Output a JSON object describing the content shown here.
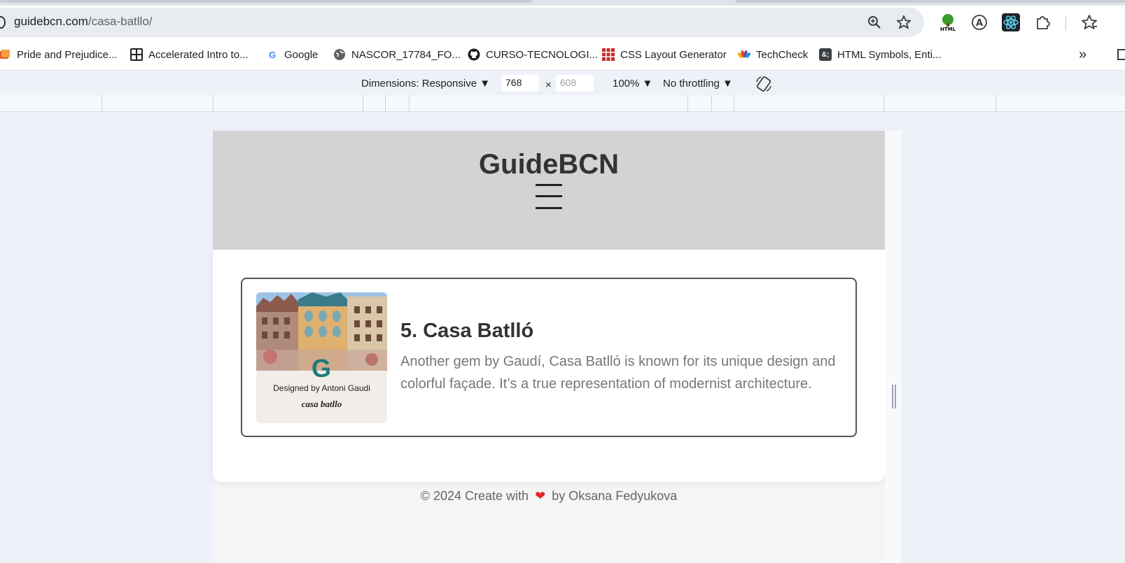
{
  "browser": {
    "url_host": "guidebcn.com",
    "url_path": "/casa-batllo/",
    "bookmarks": [
      {
        "label": "Pride and Prejudice...",
        "icon": "book-icon"
      },
      {
        "label": "Accelerated Intro to...",
        "icon": "code-grid-icon"
      },
      {
        "label": "Google",
        "icon": "google-icon"
      },
      {
        "label": "NASCOR_17784_FO...",
        "icon": "globe-icon"
      },
      {
        "label": "CURSO-TECNOLOGI...",
        "icon": "github-icon"
      },
      {
        "label": "CSS Layout Generator",
        "icon": "grid-icon"
      },
      {
        "label": "TechCheck",
        "icon": "nbc-peacock-icon"
      },
      {
        "label": "HTML Symbols, Enti...",
        "icon": "html-entity-icon"
      }
    ],
    "bookmarks_overflow": "»"
  },
  "devtools": {
    "dimensions_label": "Dimensions: Responsive ▼",
    "width_value": "768",
    "times": "×",
    "height_placeholder": "608",
    "zoom_label": "100% ▼",
    "throttle_label": "No throttling ▼"
  },
  "site": {
    "title": "GuideBCN",
    "card": {
      "title": "5. Casa Batlló",
      "description": "Another gem by Gaudí, Casa Batlló is known for its unique design and colorful façade. It’s a true representation of modernist architecture.",
      "image_caption": "Designed by Antoni Gaudi",
      "image_brand": "casa batllo",
      "image_logo": "G"
    },
    "footer_prefix": "© 2024 Create with",
    "footer_heart": "❤",
    "footer_suffix": "by Oksana Fedyukova"
  },
  "colors": {
    "header_bg": "#d3d3d3",
    "heart": "#e12727",
    "logo_teal": "#1c7a78"
  }
}
